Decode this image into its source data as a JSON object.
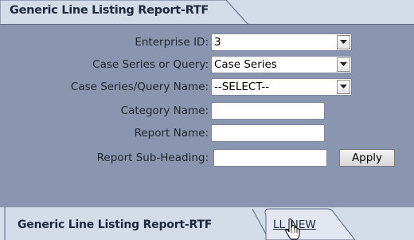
{
  "report_tab": {
    "title": "Generic Line Listing Report-RTF"
  },
  "form": {
    "enterprise_id": {
      "label": "Enterprise ID:",
      "value": "3"
    },
    "case_series_or_query": {
      "label": "Case Series or Query:",
      "value": "Case Series"
    },
    "case_series_query_name": {
      "label": "Case Series/Query Name:",
      "value": "--SELECT--"
    },
    "category_name": {
      "label": "Category Name:",
      "value": ""
    },
    "report_name": {
      "label": "Report Name:",
      "value": ""
    },
    "report_sub_heading": {
      "label": "Report Sub-Heading:",
      "value": ""
    },
    "apply_label": "Apply"
  },
  "bottom_tabs": [
    {
      "label": "Generic Line Listing Report-RTF",
      "active": true
    },
    {
      "label": "LL_NEW",
      "active": false
    }
  ],
  "colors": {
    "panel": "#8a96b0",
    "tab_bg": "#d4dbe9",
    "text": "#1e2a3c"
  }
}
